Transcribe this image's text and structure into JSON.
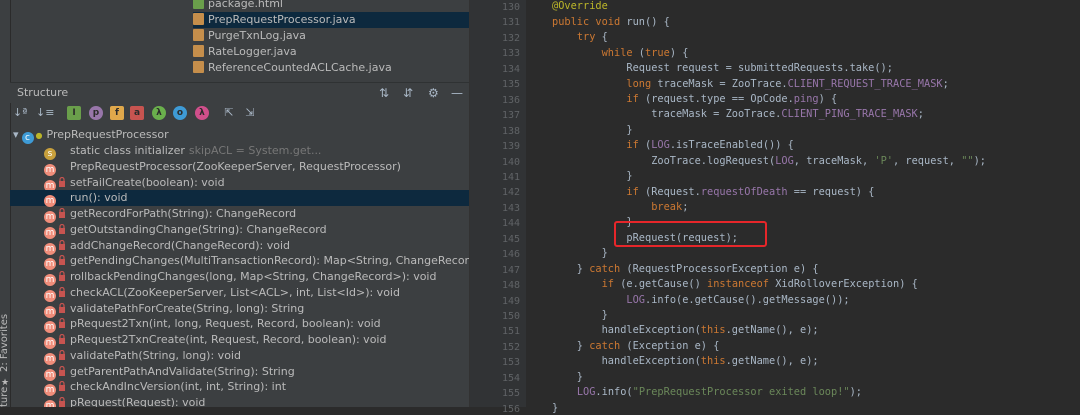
{
  "files": [
    "package.html",
    "PrepRequestProcessor.java",
    "PurgeTxnLog.java",
    "RateLogger.java",
    "ReferenceCountedACLCache.java"
  ],
  "side_tabs": {
    "favorites": "2: Favorites",
    "structure": "ture"
  },
  "structure": {
    "title": "Structure",
    "root": "PrepRequestProcessor",
    "items": [
      {
        "name": "static class initializer",
        "extra": "skipACL = System.get..."
      },
      {
        "name": "PrepRequestProcessor(ZooKeeperServer, RequestProcessor)",
        "extra": ""
      },
      {
        "name": "setFailCreate(boolean): void",
        "extra": ""
      },
      {
        "name": "run(): void",
        "extra": ""
      },
      {
        "name": "getRecordForPath(String): ChangeRecord",
        "extra": ""
      },
      {
        "name": "getOutstandingChange(String): ChangeRecord",
        "extra": ""
      },
      {
        "name": "addChangeRecord(ChangeRecord): void",
        "extra": ""
      },
      {
        "name": "getPendingChanges(MultiTransactionRecord): Map<String, ChangeRecord>",
        "extra": ""
      },
      {
        "name": "rollbackPendingChanges(long, Map<String, ChangeRecord>): void",
        "extra": ""
      },
      {
        "name": "checkACL(ZooKeeperServer, List<ACL>, int, List<Id>): void",
        "extra": ""
      },
      {
        "name": "validatePathForCreate(String, long): String",
        "extra": ""
      },
      {
        "name": "pRequest2Txn(int, long, Request, Record, boolean): void",
        "extra": ""
      },
      {
        "name": "pRequest2TxnCreate(int, Request, Record, boolean): void",
        "extra": ""
      },
      {
        "name": "validatePath(String, long): void",
        "extra": ""
      },
      {
        "name": "getParentPathAndValidate(String): String",
        "extra": ""
      },
      {
        "name": "checkAndIncVersion(int, int, String): int",
        "extra": ""
      },
      {
        "name": "pRequest(Request): void",
        "extra": ""
      }
    ]
  },
  "editor": {
    "line_numbers": [
      "130",
      "131",
      "132",
      "133",
      "134",
      "135",
      "136",
      "137",
      "138",
      "139",
      "140",
      "141",
      "142",
      "143",
      "144",
      "145",
      "146",
      "147",
      "148",
      "149",
      "150",
      "151",
      "152",
      "153",
      "154",
      "155",
      "156"
    ],
    "highlight_color": "#e6262a"
  }
}
